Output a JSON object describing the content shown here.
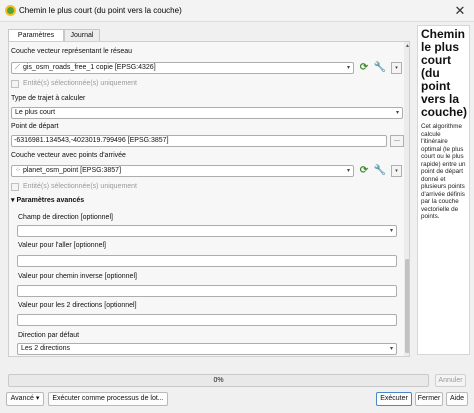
{
  "window": {
    "title": "Chemin le plus court (du point vers la couche)",
    "close_glyph": "✕"
  },
  "tabs": [
    {
      "label": "Paramètres",
      "active": true
    },
    {
      "label": "Journal",
      "active": false
    }
  ],
  "params": {
    "network_label": "Couche vecteur représentant le réseau",
    "network_value": "gis_osm_roads_free_1 copie [EPSG:4326]",
    "network_selected_only": "Entité(s) sélectionnée(s) uniquement",
    "route_type_label": "Type de trajet à calculer",
    "route_type_value": "Le plus court",
    "start_point_label": "Point de départ",
    "start_point_value": "-6316981.134543,-4023019.799496 [EPSG:3857]",
    "start_point_browse": "...",
    "end_points_label": "Couche vecteur avec points d'arrivée",
    "end_points_value": "planet_osm_point [EPSG:3857]",
    "end_points_selected_only": "Entité(s) sélectionnée(s) uniquement",
    "advanced_title": "Paramètres avancés",
    "direction_field_label": "Champ de direction [optionnel]",
    "direction_field_value": "",
    "forward_value_label": "Valeur pour l'aller [optionnel]",
    "forward_value_value": "",
    "backward_value_label": "Valeur pour chemin inverse [optionnel]",
    "backward_value_value": "",
    "both_value_label": "Valeur pour les 2 directions [optionnel]",
    "both_value_value": "",
    "default_direction_label": "Direction par défaut",
    "default_direction_value": "Les 2 directions"
  },
  "help": {
    "title": "Chemin le plus court (du point vers la couche)",
    "body": "Cet algorithme calcule l'itinéraire optimal (le plus court ou le plus rapide) entre un point de départ donné et plusieurs points d'arrivée définis par la couche vectorielle de points."
  },
  "progress": {
    "text": "0%",
    "value": 0,
    "cancel_label": "Annuler"
  },
  "footer": {
    "advanced_label": "Avancé",
    "batch_label": "Exécuter comme processus de lot...",
    "run_label": "Exécuter",
    "close_label": "Fermer",
    "help_label": "Aide"
  },
  "icons": {
    "combo_arrow": "▾",
    "refresh": "⟳",
    "wrench": "🔧",
    "line_geom": "⟋",
    "point_geom": "⁘"
  },
  "colors": {
    "accent_blue": "#4a86c8",
    "refresh_green": "#3c8d2f"
  }
}
